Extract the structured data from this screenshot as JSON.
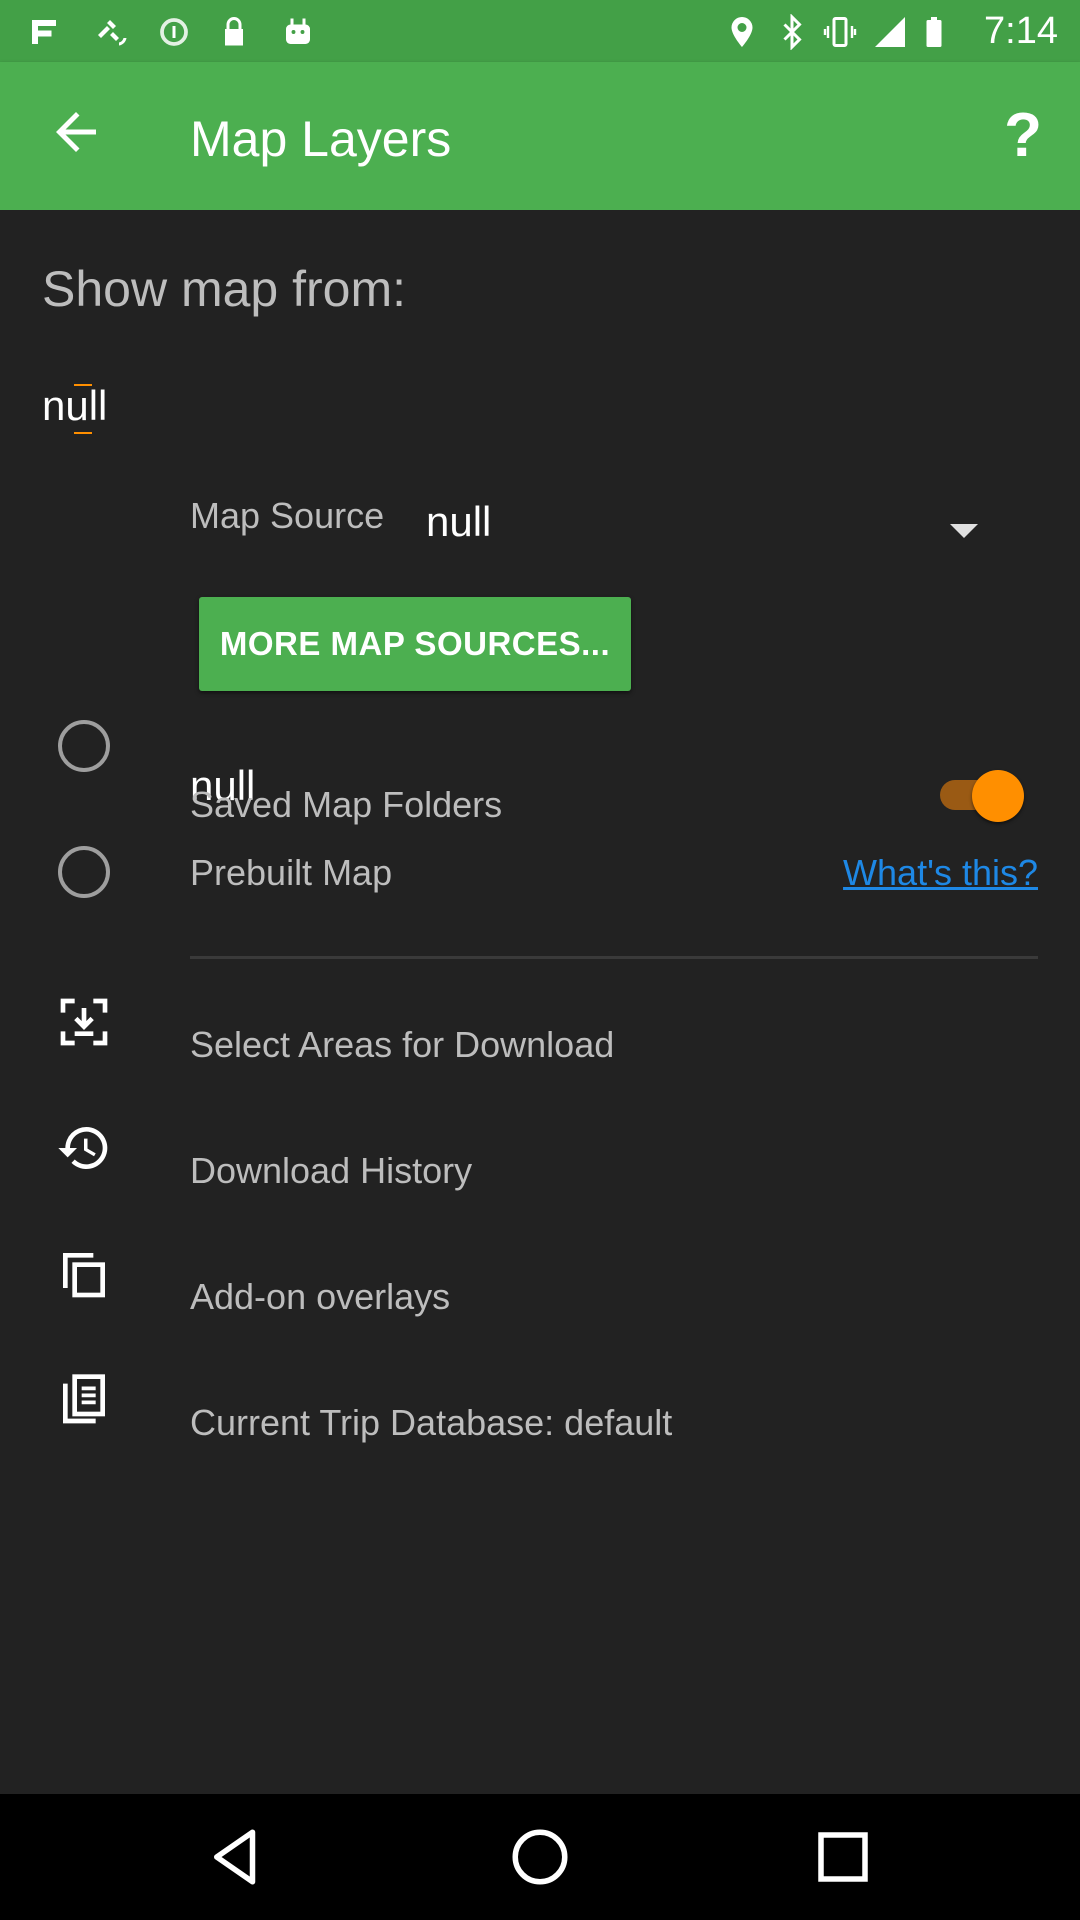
{
  "status_bar": {
    "time": "7:14",
    "icons": [
      "fake-gps-icon",
      "satellite-icon",
      "data-saver-icon",
      "lock-icon",
      "android-icon",
      "location-icon",
      "bluetooth-icon",
      "vibrate-icon",
      "signal-icon",
      "battery-icon"
    ]
  },
  "app_bar": {
    "title": "Map Layers",
    "help": "?"
  },
  "content": {
    "heading": "Show map from:",
    "null_top": "null",
    "map_source_label": "Map Source",
    "map_source_value": "null",
    "more_button": "MORE MAP SOURCES...",
    "toggle_label": "null",
    "toggle_on": true,
    "saved_folders": "Saved Map Folders",
    "prebuilt_map": "Prebuilt Map",
    "whats_this": "What's this?",
    "menu": [
      {
        "label": "Select Areas for Download",
        "icon": "download-area-icon"
      },
      {
        "label": "Download History",
        "icon": "history-icon"
      },
      {
        "label": "Add-on overlays",
        "icon": "overlays-icon"
      },
      {
        "label": "Current Trip Database: default",
        "icon": "database-icon"
      }
    ]
  },
  "colors": {
    "app_bar": "#4caf50",
    "status_bar": "#43a047",
    "background": "#222222",
    "accent": "#ff8f00",
    "link": "#1e88e5"
  }
}
